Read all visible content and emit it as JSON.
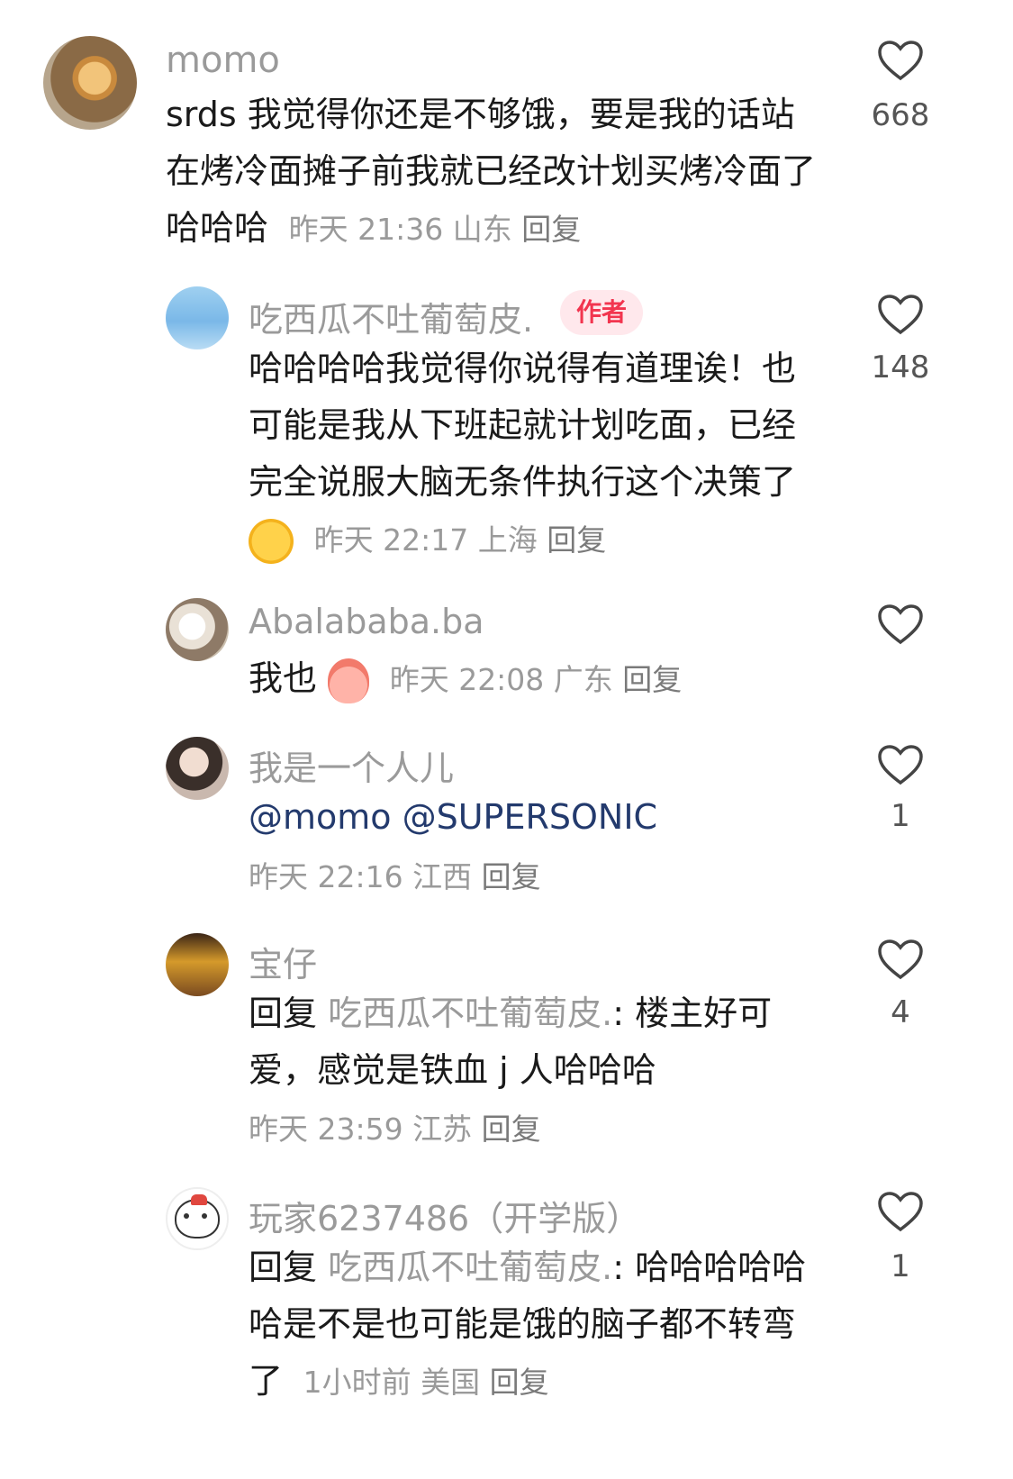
{
  "comments": [
    {
      "name": "momo",
      "text": "srds 我觉得你还是不够饿，要是我的话站在烤冷面摊子前我就已经改计划买烤冷面了哈哈哈",
      "time": "昨天 21:36",
      "location": "山东",
      "reply_label": "回复",
      "likes": "668"
    },
    {
      "name": "吃西瓜不吐葡萄皮.",
      "badge": "作者",
      "text": "哈哈哈哈我觉得你说得有道理诶！也可能是我从下班起就计划吃面，已经完全说服大脑无条件执行这个决策了",
      "emoji": "laughing-tears-emoji",
      "time": "昨天 22:17",
      "location": "上海",
      "reply_label": "回复",
      "likes": "148"
    },
    {
      "name": "Abalababa.ba",
      "text": "我也",
      "emoji": "peach-emoji",
      "time": "昨天 22:08",
      "location": "广东",
      "reply_label": "回复",
      "likes": ""
    },
    {
      "name": "我是一个人儿",
      "mention1": "@momo",
      "mention2": "@SUPERSONIC",
      "time": "昨天 22:16",
      "location": "江西",
      "reply_label": "回复",
      "likes": "1"
    },
    {
      "name": "宝仔",
      "reply_prefix": "回复",
      "reply_to": "吃西瓜不吐葡萄皮.",
      "colon": ":",
      "text": "楼主好可爱，感觉是铁血 j 人哈哈哈",
      "time": "昨天 23:59",
      "location": "江苏",
      "reply_label": "回复",
      "likes": "4"
    },
    {
      "name": "玩家6237486（开学版）",
      "reply_prefix": "回复",
      "reply_to": "吃西瓜不吐葡萄皮.",
      "colon": ":",
      "text": "哈哈哈哈哈哈是不是也可能是饿的脑子都不转弯了",
      "time": "1小时前",
      "location": "美国",
      "reply_label": "回复",
      "likes": "1"
    }
  ]
}
